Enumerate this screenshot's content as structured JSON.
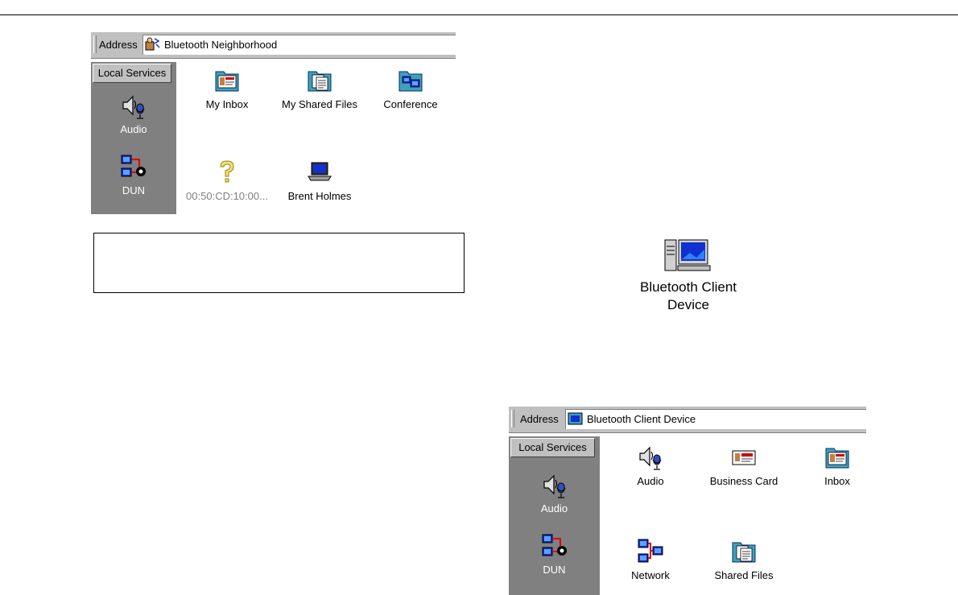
{
  "window1": {
    "address_label": "Address",
    "address_value": "Bluetooth Neighborhood",
    "sidebar_header": "Local Services",
    "sidebar_items": [
      {
        "label": "Audio",
        "icon": "speaker-mic-icon"
      },
      {
        "label": "DUN",
        "icon": "dial-up-network-icon"
      }
    ],
    "items": [
      {
        "label": "My Inbox",
        "icon": "inbox-folder-icon"
      },
      {
        "label": "My Shared Files",
        "icon": "shared-files-folder-icon"
      },
      {
        "label": "Conference",
        "icon": "conference-folder-icon"
      },
      {
        "label": "00:50:CD:10:00...",
        "icon": "unknown-device-icon"
      },
      {
        "label": "Brent Holmes",
        "icon": "laptop-icon"
      }
    ]
  },
  "client_device": {
    "label_line1": "Bluetooth Client",
    "label_line2": "Device",
    "icon": "desktop-computer-icon"
  },
  "window2": {
    "address_label": "Address",
    "address_value": "Bluetooth Client Device",
    "sidebar_header": "Local Services",
    "sidebar_items": [
      {
        "label": "Audio",
        "icon": "speaker-mic-icon"
      },
      {
        "label": "DUN",
        "icon": "dial-up-network-icon"
      }
    ],
    "items": [
      {
        "label": "Audio",
        "icon": "speaker-mic-icon"
      },
      {
        "label": "Business Card",
        "icon": "business-card-icon"
      },
      {
        "label": "Inbox",
        "icon": "inbox-folder-icon"
      },
      {
        "label": "Network",
        "icon": "network-icon"
      },
      {
        "label": "Shared Files",
        "icon": "shared-files-folder-icon"
      }
    ]
  },
  "colors": {
    "sidebar_bg": "#808080",
    "chrome_bg": "#c0c0c0",
    "icon_blue": "#0000c0",
    "folder_teal": "#40a0c0"
  }
}
